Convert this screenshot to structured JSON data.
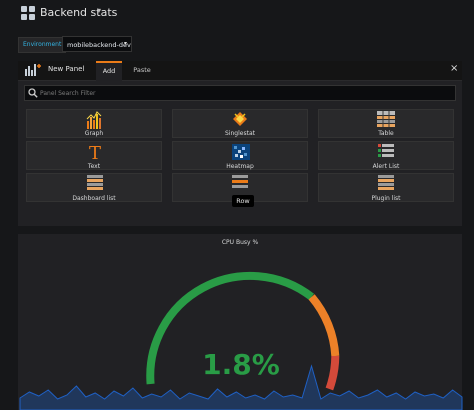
{
  "dashboard": {
    "title": "Backend stats",
    "caret": "▾"
  },
  "environment": {
    "label": "Environment:",
    "value": "mobilebackend-dev",
    "caret": "▾"
  },
  "add_panel": {
    "title": "New Panel",
    "tabs": [
      {
        "label": "Add",
        "active": true
      },
      {
        "label": "Paste",
        "active": false
      }
    ],
    "close": "×",
    "search_placeholder": "Panel Search Filter",
    "search_value": "",
    "items": [
      {
        "label": "Graph",
        "icon": "graph-icon"
      },
      {
        "label": "Singlestat",
        "icon": "singlestat-icon"
      },
      {
        "label": "Table",
        "icon": "table-icon"
      },
      {
        "label": "Text",
        "icon": "text-icon"
      },
      {
        "label": "Heatmap",
        "icon": "heatmap-icon"
      },
      {
        "label": "Alert List",
        "icon": "alert-list-icon"
      },
      {
        "label": "Dashboard list",
        "icon": "dashboard-list-icon"
      },
      {
        "label": "",
        "icon": "row-icon"
      },
      {
        "label": "Plugin list",
        "icon": "plugin-list-icon"
      }
    ],
    "tooltip": "Row"
  },
  "gauge_panel": {
    "title": "CPU Busy %",
    "value": "1.8%",
    "value_fraction": 0.018,
    "colors": {
      "ok": "#299c46",
      "warn": "#ed8128",
      "crit": "#d44a3a",
      "spark": "#1f60c4"
    }
  }
}
